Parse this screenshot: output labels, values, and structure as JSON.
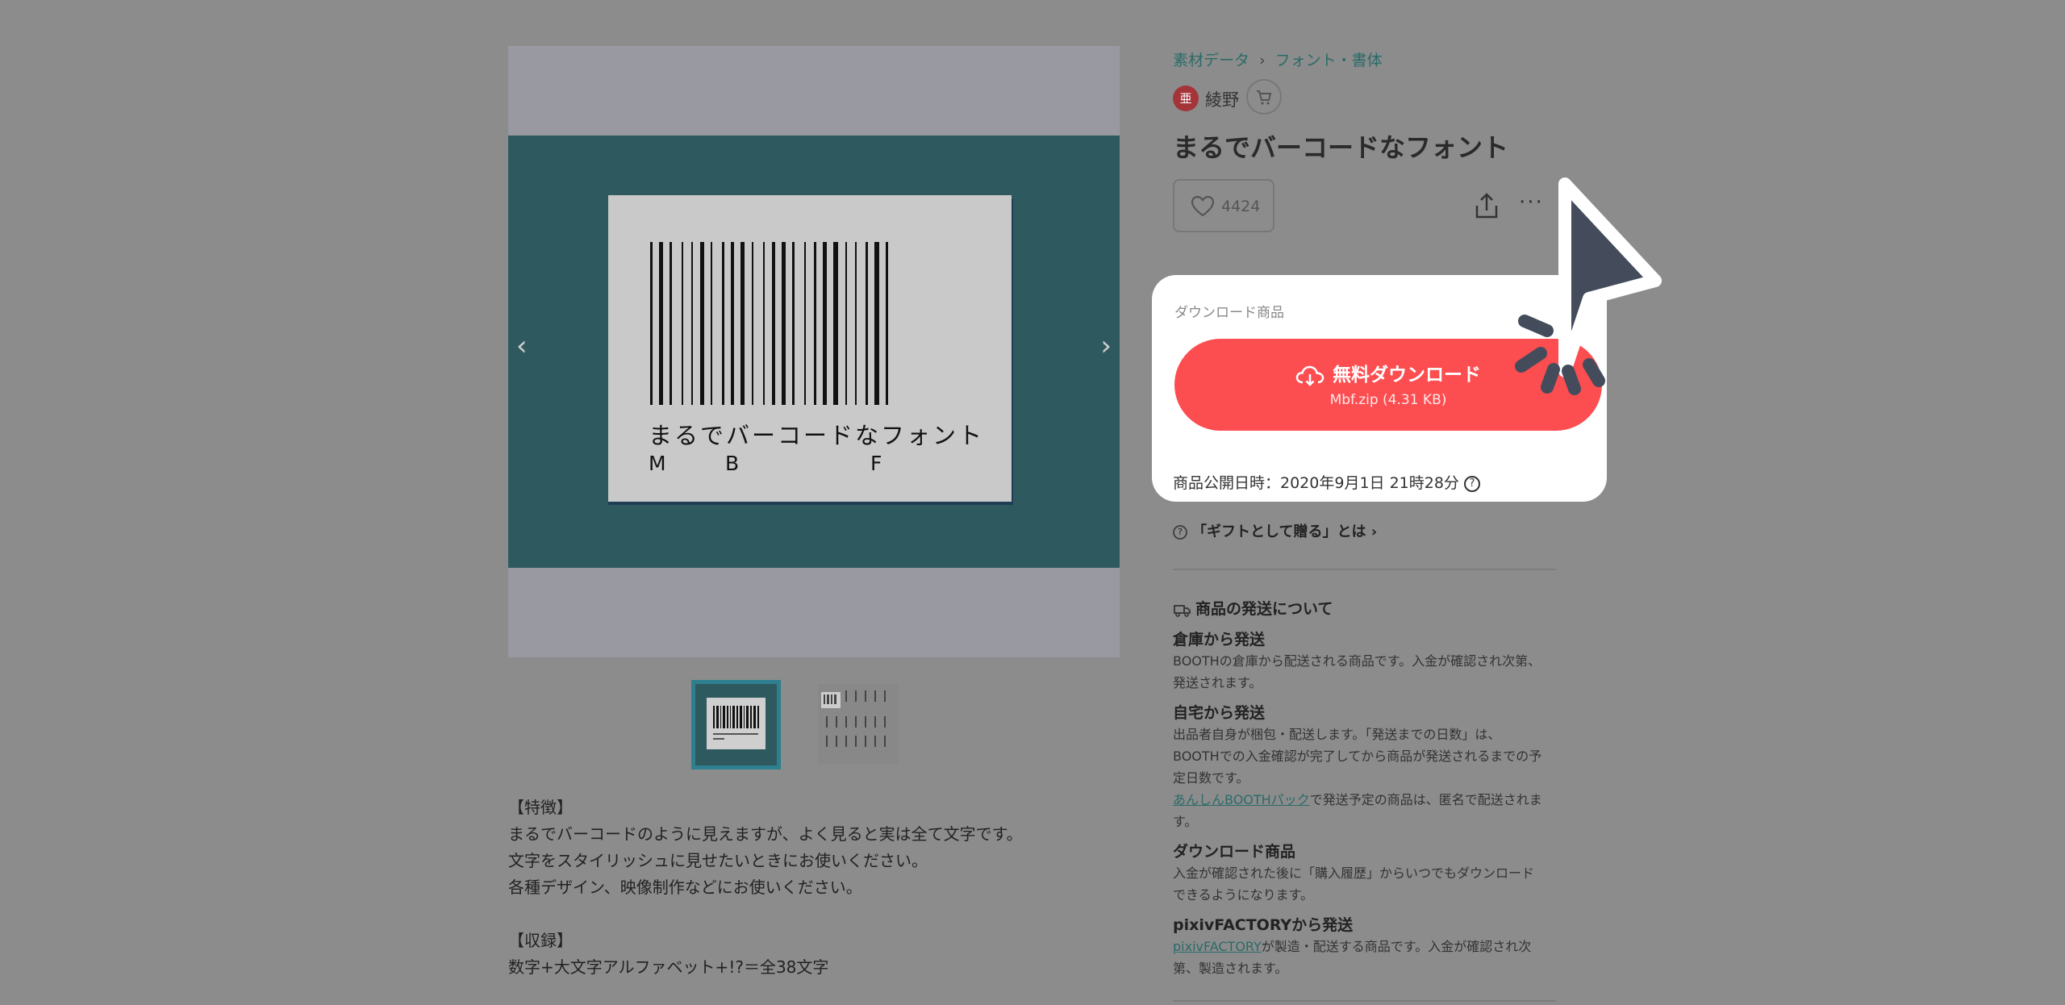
{
  "gallery": {
    "card_title": "まるでバーコードなフォント",
    "card_sub": [
      "M",
      "B",
      "F"
    ],
    "prev_arrow": "‹",
    "next_arrow": "›",
    "thumbnails": [
      "thumbnail-1",
      "thumbnail-2"
    ]
  },
  "description": {
    "lines": [
      "【特徴】",
      "まるでバーコードのように見えますが、よく見ると実は全て文字です。",
      "文字をスタイリッシュに見せたいときにお使いください。",
      "各種デザイン、映像制作などにお使いください。",
      "",
      "【収録】",
      "数字+大文字アルファベット+!?＝全38文字"
    ]
  },
  "breadcrumb": {
    "category": "素材データ",
    "subcategory": "フォント・書体"
  },
  "shop": {
    "icon_text": "亜",
    "name": "綾野"
  },
  "product": {
    "title": "まるでバーコードなフォント",
    "likes": "4424"
  },
  "download": {
    "section_label": "ダウンロード商品",
    "button_label": "無料ダウンロード",
    "file_info": "Mbf.zip (4.31 KB)",
    "published": "商品公開日時：2020年9月1日 21時28分"
  },
  "gift": {
    "label": "「ギフトとして贈る」とは"
  },
  "shipping": {
    "heading": "商品の発送について",
    "warehouse": {
      "title": "倉庫から発送",
      "text": [
        "BOOTHの倉庫から配送される商品です。入金が確認され次第、",
        "発送されます。"
      ]
    },
    "home": {
      "title": "自宅から発送",
      "text": [
        "出品者自身が梱包・配送します。「発送までの日数」は、",
        "BOOTHでの入金確認が完了してから商品が発送されるまでの予",
        "定日数です。"
      ],
      "link": "あんしんBOOTHパック",
      "link_rest": "で発送予定の商品は、匿名で配送されま",
      "last": "す。"
    },
    "download": {
      "title": "ダウンロード商品",
      "text": [
        "入金が確認された後に「購入履歴」からいつでもダウンロード",
        "できるようになります。"
      ]
    },
    "factory": {
      "title": "pixivFACTORYから発送",
      "link": "pixivFACTORY",
      "link_rest": "が製造・配送する商品です。入金が確認され次",
      "last": "第、製造されます。"
    }
  },
  "colors": {
    "accent": "#fc4d50",
    "teal": "#2e5a5f",
    "link": "#2b6b68",
    "overlay": "#8c8c8c"
  }
}
